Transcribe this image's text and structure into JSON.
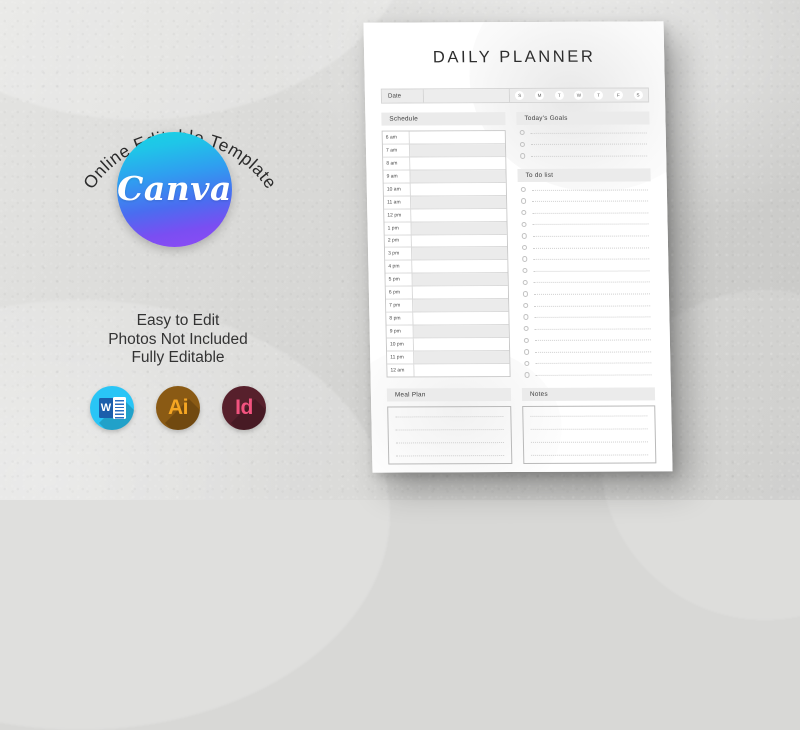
{
  "promo": {
    "badge_arc_text": "Online Editable Template",
    "badge_wordmark": "Canva",
    "features": [
      "Easy to Edit",
      "Photos Not Included",
      "Fully Editable"
    ],
    "app_icons": [
      {
        "name": "microsoft-word",
        "glyph": "W",
        "color": "#29c5f6"
      },
      {
        "name": "adobe-illustrator",
        "glyph": "Ai",
        "color": "#8a5a14"
      },
      {
        "name": "adobe-indesign",
        "glyph": "Id",
        "color": "#57202c"
      }
    ],
    "accent_gradient_start": "#17d4e3",
    "accent_gradient_end": "#8f4bf5"
  },
  "planner": {
    "title": "DAILY PLANNER",
    "date_label": "Date",
    "date_value": "",
    "days": [
      "S",
      "M",
      "T",
      "W",
      "T",
      "F",
      "S"
    ],
    "sections": {
      "schedule": "Schedule",
      "goals": "Today's Goals",
      "todo": "To do list",
      "meal": "Meal Plan",
      "notes": "Notes"
    },
    "schedule_times": [
      "6 am",
      "7 am",
      "8 am",
      "9 am",
      "10 am",
      "11 am",
      "12 pm",
      "1 pm",
      "2 pm",
      "3 pm",
      "4 pm",
      "5 pm",
      "6 pm",
      "7 pm",
      "8 pm",
      "9 pm",
      "10 pm",
      "11 pm",
      "12 am"
    ],
    "schedule_entries": [
      "",
      "",
      "",
      "",
      "",
      "",
      "",
      "",
      "",
      "",
      "",
      "",
      "",
      "",
      "",
      "",
      "",
      "",
      ""
    ],
    "goals_rows": 3,
    "goals_entries": [
      "",
      "",
      ""
    ],
    "todo_rows": 17,
    "todo_entries": [
      "",
      "",
      "",
      "",
      "",
      "",
      "",
      "",
      "",
      "",
      "",
      "",
      "",
      "",
      "",
      "",
      ""
    ],
    "meal_lines": 4,
    "notes_lines": 4,
    "paper_color": "#ffffff",
    "header_fill": "#ebebeb",
    "row_alt_fill": "#ebebeb"
  }
}
